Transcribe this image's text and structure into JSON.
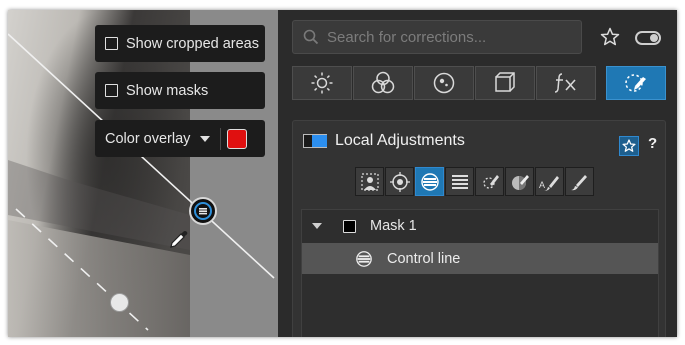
{
  "canvas": {
    "show_cropped_areas_label": "Show cropped areas",
    "show_cropped_areas_checked": false,
    "show_masks_label": "Show masks",
    "show_masks_checked": false,
    "overlay_label": "Color overlay",
    "overlay_color": "#e01010"
  },
  "panel": {
    "search_placeholder": "Search for corrections...",
    "tool_tabs": [
      {
        "name": "light-icon"
      },
      {
        "name": "color-icon"
      },
      {
        "name": "detail-icon"
      },
      {
        "name": "geometry-icon"
      },
      {
        "name": "effects-icon"
      },
      {
        "name": "local-adjustments-icon"
      }
    ],
    "section": {
      "title": "Local Adjustments",
      "help": "?",
      "accent_color": "#1f78b4"
    },
    "mask_tools": [
      "selection-tool-icon",
      "control-point-icon",
      "control-line-icon",
      "graduated-filter-icon",
      "auto-mask-icon",
      "luminosity-mask-icon",
      "auto-brush-icon",
      "brush-icon"
    ],
    "masks": [
      {
        "label": "Mask 1",
        "expanded": true,
        "children": [
          {
            "label": "Control line",
            "selected": true
          }
        ]
      }
    ]
  }
}
